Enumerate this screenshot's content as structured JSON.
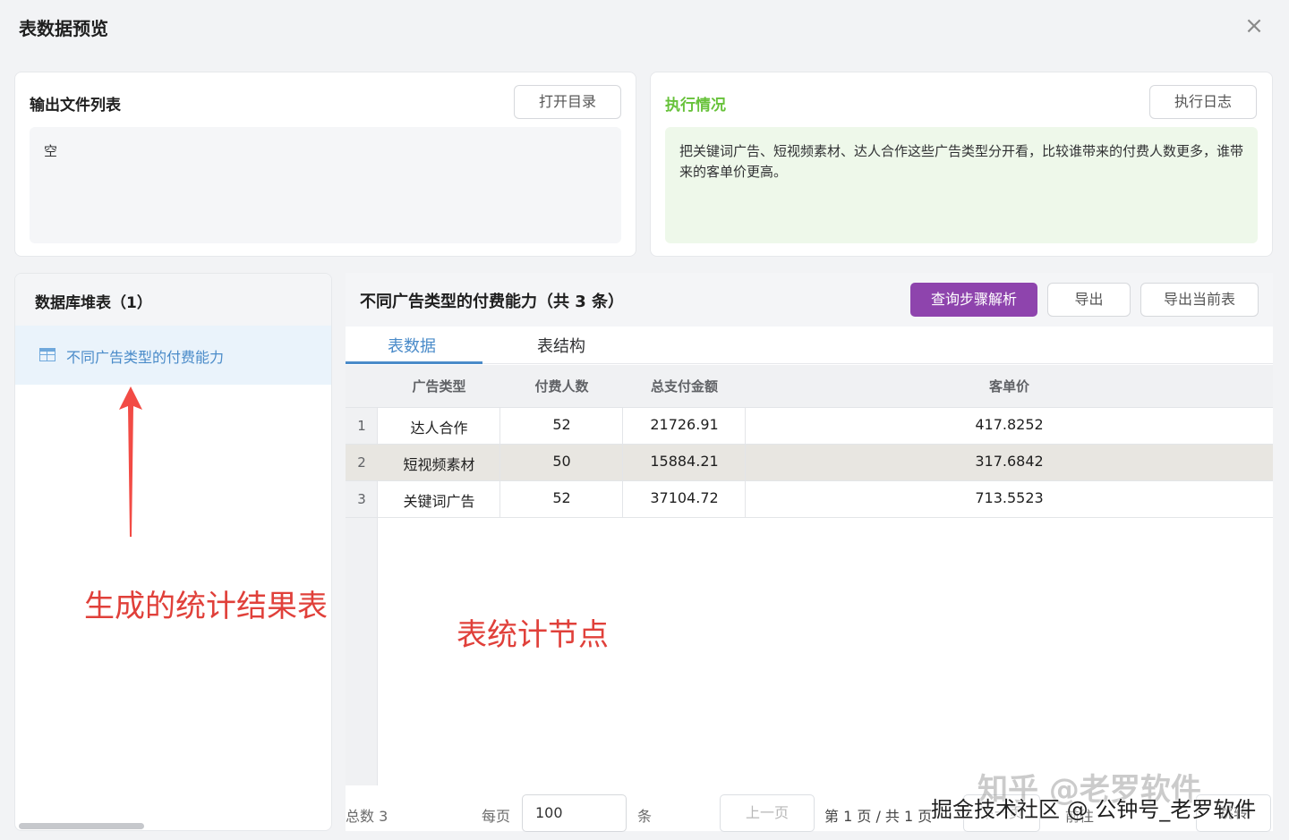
{
  "window": {
    "title": "表数据预览",
    "close_glyph": "×"
  },
  "output_files": {
    "title": "输出文件列表",
    "open_dir_label": "打开目录",
    "content": "空"
  },
  "execution": {
    "title": "执行情况",
    "log_label": "执行日志",
    "content": "把关键词广告、短视频素材、达人合作这些广告类型分开看，比较谁带来的付费人数更多，谁带来的客单价更高。",
    "accent_color": "#67c23a"
  },
  "db_tables": {
    "title": "数据库堆表（1）",
    "items": [
      {
        "label": "不同广告类型的付费能力"
      }
    ]
  },
  "table_view": {
    "title": "不同广告类型的付费能力（共 3 条）",
    "query_steps_label": "查询步骤解析",
    "export_label": "导出",
    "export_current_label": "导出当前表",
    "primary_color": "#8e44ad",
    "tabs": [
      {
        "label": "表数据",
        "active": true
      },
      {
        "label": "表结构",
        "active": false
      }
    ],
    "columns": [
      "广告类型",
      "付费人数",
      "总支付金额",
      "客单价"
    ],
    "rows": [
      {
        "index": "1",
        "cells": [
          "达人合作",
          "52",
          "21726.91",
          "417.8252"
        ]
      },
      {
        "index": "2",
        "cells": [
          "短视频素材",
          "50",
          "15884.21",
          "317.6842"
        ],
        "selected": true
      },
      {
        "index": "3",
        "cells": [
          "关键词广告",
          "52",
          "37104.72",
          "713.5523"
        ]
      }
    ]
  },
  "pagination": {
    "total": "总数 3",
    "per_page_label": "每页",
    "per_page_value": "100",
    "per_page_unit": "条",
    "prev_label": "上一页",
    "page_info": "第 1 页 / 共 1 页",
    "next_label": "下一页",
    "goto_prefix": "前往",
    "goto_label": "跳转"
  },
  "annotations": {
    "result_table": "生成的统计结果表",
    "stat_node": "表统计节点"
  },
  "watermarks": {
    "zhihu": "知乎 @老罗软件",
    "juejin": "掘金技术社区 @ 公钟号_老罗软件"
  }
}
